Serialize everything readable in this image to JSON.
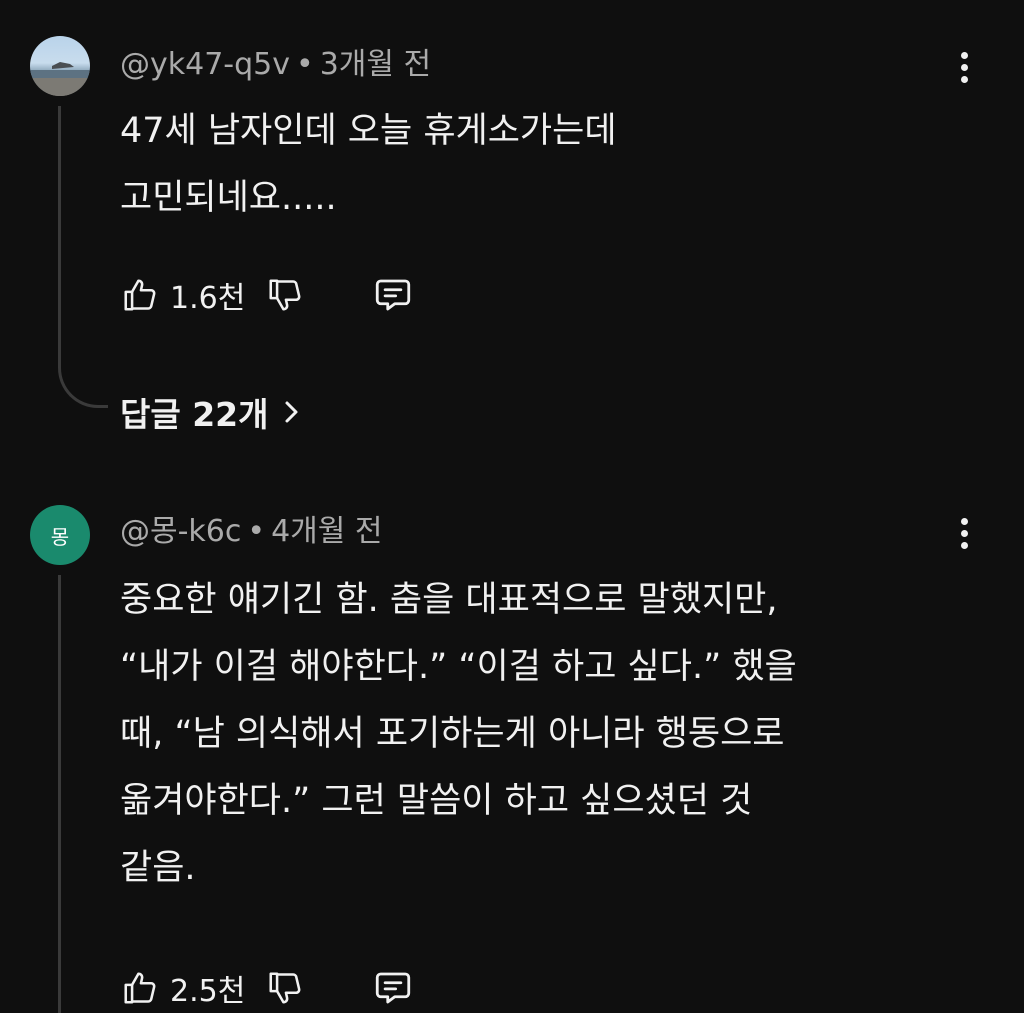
{
  "comments": [
    {
      "author": "@yk47-q5v",
      "time": "3개월 전",
      "lines": [
        "47세 남자인데 오늘 휴게소가는데",
        "고민되네요....."
      ],
      "likes": "1.6천",
      "replies_label": "답글 22개",
      "avatar": "photo-avatar"
    },
    {
      "author": "@몽-k6c",
      "time": "4개월 전",
      "avatar_letter": "몽",
      "lines": [
        "중요한 얘기긴 함. 춤을 대표적으로 말했지만,",
        "“내가 이걸 해야한다.” “이걸 하고 싶다.” 했을",
        "때, “남 의식해서 포기하는게 아니라 행동으로",
        "옮겨야한다.” 그런 말씀이 하고 싶으셨던 것",
        "같음."
      ],
      "likes": "2.5천"
    }
  ],
  "separator": "•",
  "icons": {
    "like": "thumbs-up-icon",
    "dislike": "thumbs-down-icon",
    "reply": "reply-icon",
    "more": "more-vert-icon",
    "chevron": "chevron-right-icon"
  },
  "colors": {
    "background": "#0f0f0f",
    "text_primary": "#f1f1f1",
    "text_secondary": "#aaaaaa",
    "avatar_green": "#1a8a6d",
    "thread_line": "#3a3a3a"
  }
}
